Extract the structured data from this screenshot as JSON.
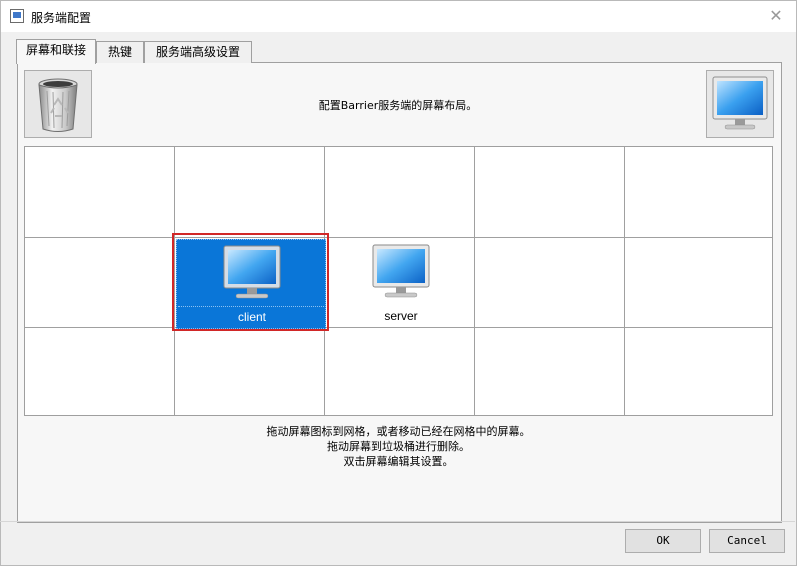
{
  "window": {
    "title": "服务端配置"
  },
  "tabs": [
    {
      "label": "屏幕和联接",
      "active": true
    },
    {
      "label": "热键",
      "active": false
    },
    {
      "label": "服务端高级设置",
      "active": false
    }
  ],
  "screens_tab": {
    "hint": "配置Barrier服务端的屏幕布局。",
    "trash_icon": "recycle-bin-icon",
    "new_screen_icon": "monitor-icon",
    "grid": {
      "columns": 5,
      "rows": 3,
      "screens": [
        {
          "name": "client",
          "column": 2,
          "row": 2,
          "selected": true
        },
        {
          "name": "server",
          "column": 3,
          "row": 2,
          "selected": false
        }
      ]
    },
    "instructions": [
      "拖动屏幕图标到网格，或者移动已经在网格中的屏幕。",
      "拖动屏幕到垃圾桶进行删除。",
      "双击屏幕编辑其设置。"
    ]
  },
  "buttons": {
    "ok": "OK",
    "cancel": "Cancel"
  },
  "colors": {
    "selection": "#0a76d8",
    "highlight_outline": "#d12727"
  }
}
